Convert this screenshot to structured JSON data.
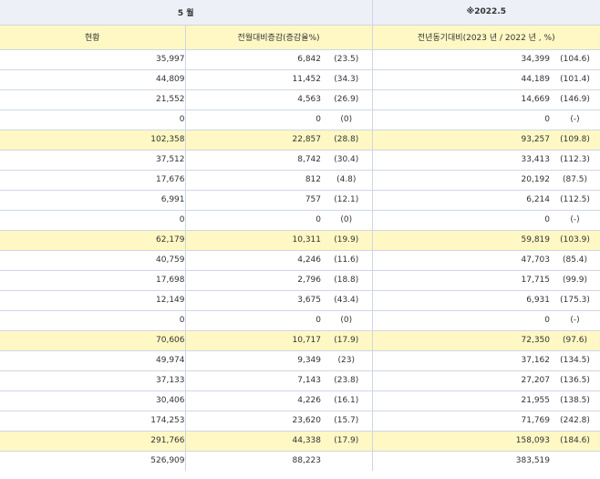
{
  "header": {
    "month": "5 월",
    "ref_year": "※2022.5",
    "col_status": "현황",
    "col_mom": "전월대비증감(증감율%)",
    "col_yoy": "전년동기대비(2023 년 / 2022 년 , %)"
  },
  "rows": [
    {
      "value": "35,997",
      "change": "6,842",
      "change_pct": "(23.5)",
      "prev_year": "34,399",
      "yoy_pct": "(104.6)",
      "subtotal": false
    },
    {
      "value": "44,809",
      "change": "11,452",
      "change_pct": "(34.3)",
      "prev_year": "44,189",
      "yoy_pct": "(101.4)",
      "subtotal": false
    },
    {
      "value": "21,552",
      "change": "4,563",
      "change_pct": "(26.9)",
      "prev_year": "14,669",
      "yoy_pct": "(146.9)",
      "subtotal": false
    },
    {
      "value": "0",
      "change": "0",
      "change_pct": "(0)",
      "prev_year": "0",
      "yoy_pct": "(-)",
      "subtotal": false
    },
    {
      "value": "102,358",
      "change": "22,857",
      "change_pct": "(28.8)",
      "prev_year": "93,257",
      "yoy_pct": "(109.8)",
      "subtotal": true
    },
    {
      "value": "37,512",
      "change": "8,742",
      "change_pct": "(30.4)",
      "prev_year": "33,413",
      "yoy_pct": "(112.3)",
      "subtotal": false
    },
    {
      "value": "17,676",
      "change": "812",
      "change_pct": "(4.8)",
      "prev_year": "20,192",
      "yoy_pct": "(87.5)",
      "subtotal": false
    },
    {
      "value": "6,991",
      "change": "757",
      "change_pct": "(12.1)",
      "prev_year": "6,214",
      "yoy_pct": "(112.5)",
      "subtotal": false
    },
    {
      "value": "0",
      "change": "0",
      "change_pct": "(0)",
      "prev_year": "0",
      "yoy_pct": "(-)",
      "subtotal": false
    },
    {
      "value": "62,179",
      "change": "10,311",
      "change_pct": "(19.9)",
      "prev_year": "59,819",
      "yoy_pct": "(103.9)",
      "subtotal": true
    },
    {
      "value": "40,759",
      "change": "4,246",
      "change_pct": "(11.6)",
      "prev_year": "47,703",
      "yoy_pct": "(85.4)",
      "subtotal": false
    },
    {
      "value": "17,698",
      "change": "2,796",
      "change_pct": "(18.8)",
      "prev_year": "17,715",
      "yoy_pct": "(99.9)",
      "subtotal": false
    },
    {
      "value": "12,149",
      "change": "3,675",
      "change_pct": "(43.4)",
      "prev_year": "6,931",
      "yoy_pct": "(175.3)",
      "subtotal": false
    },
    {
      "value": "0",
      "change": "0",
      "change_pct": "(0)",
      "prev_year": "0",
      "yoy_pct": "(-)",
      "subtotal": false
    },
    {
      "value": "70,606",
      "change": "10,717",
      "change_pct": "(17.9)",
      "prev_year": "72,350",
      "yoy_pct": "(97.6)",
      "subtotal": true
    },
    {
      "value": "49,974",
      "change": "9,349",
      "change_pct": "(23)",
      "prev_year": "37,162",
      "yoy_pct": "(134.5)",
      "subtotal": false
    },
    {
      "value": "37,133",
      "change": "7,143",
      "change_pct": "(23.8)",
      "prev_year": "27,207",
      "yoy_pct": "(136.5)",
      "subtotal": false
    },
    {
      "value": "30,406",
      "change": "4,226",
      "change_pct": "(16.1)",
      "prev_year": "21,955",
      "yoy_pct": "(138.5)",
      "subtotal": false
    },
    {
      "value": "174,253",
      "change": "23,620",
      "change_pct": "(15.7)",
      "prev_year": "71,769",
      "yoy_pct": "(242.8)",
      "subtotal": false
    },
    {
      "value": "291,766",
      "change": "44,338",
      "change_pct": "(17.9)",
      "prev_year": "158,093",
      "yoy_pct": "(184.6)",
      "subtotal": true
    },
    {
      "value": "526,909",
      "change": "88,223",
      "change_pct": "",
      "prev_year": "383,519",
      "yoy_pct": "",
      "subtotal": false
    }
  ]
}
